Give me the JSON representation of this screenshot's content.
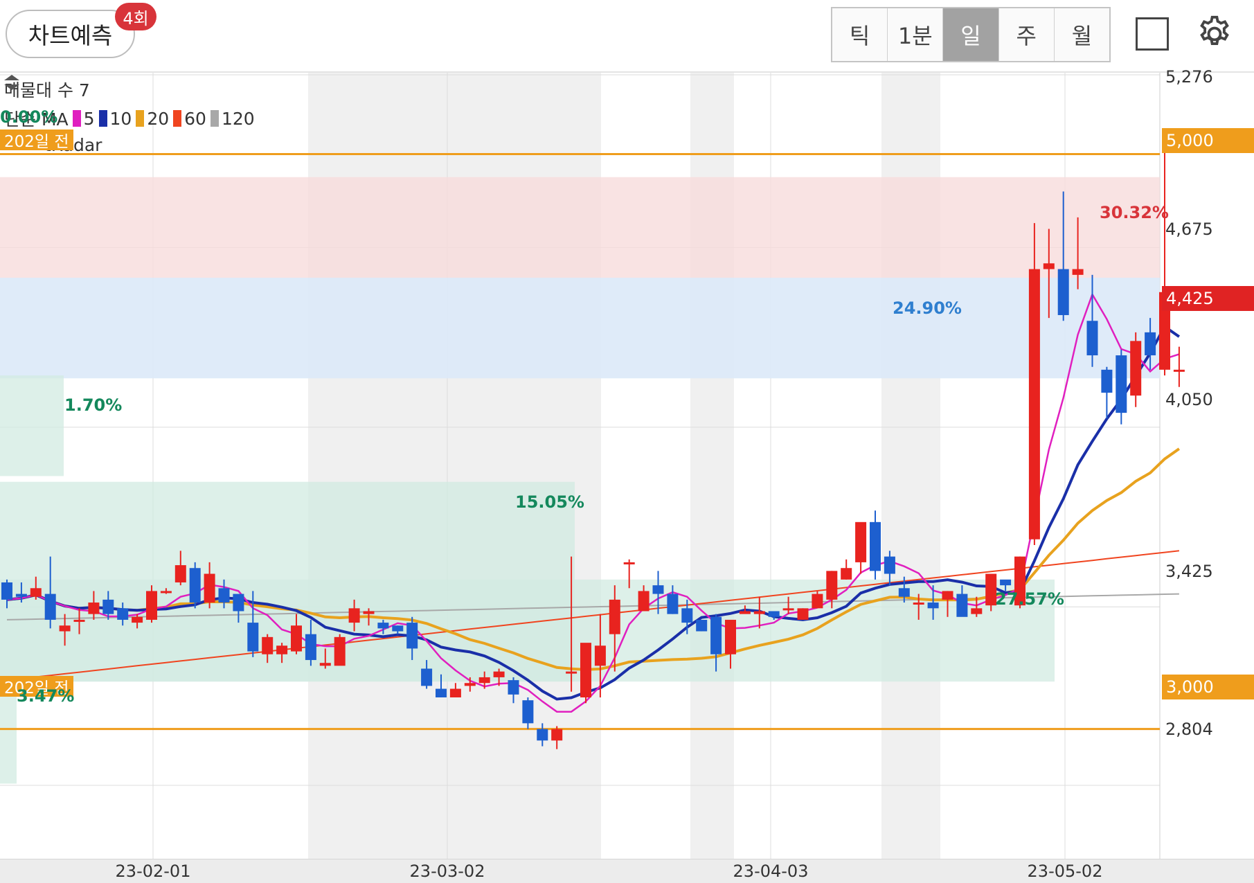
{
  "header": {
    "predict_label": "차트예측",
    "predict_badge": "4회",
    "periods": [
      "틱",
      "1분",
      "일",
      "주",
      "월"
    ],
    "active_period": "일",
    "icons": [
      "square-icon",
      "gear-icon"
    ]
  },
  "legend": {
    "volume_profile_label": "매물대 수 7",
    "ma_prefix": "단순 MA",
    "ma_items": [
      {
        "label": "5",
        "color": "#e01fbf"
      },
      {
        "label": "10",
        "color": "#1a2fa8"
      },
      {
        "label": "20",
        "color": "#e8a21e"
      },
      {
        "label": "60",
        "color": "#f0441f"
      },
      {
        "label": "120",
        "color": "#a8a8a8"
      }
    ],
    "radar_label": "tRadar"
  },
  "y_axis": {
    "ticks": [
      "5,276",
      "4,675",
      "4,050",
      "3,425",
      "2,804"
    ],
    "tags": [
      {
        "text": "5,000",
        "color": "#ef9d1c"
      },
      {
        "text": "4,425",
        "color": "#e02323"
      },
      {
        "text": "3,000",
        "color": "#ef9d1c"
      }
    ]
  },
  "x_axis": {
    "ticks": [
      "23-02-01",
      "23-03-02",
      "23-04-03",
      "23-05-02"
    ]
  },
  "level_lines": [
    {
      "value": 5000,
      "label": "202일 전"
    },
    {
      "value": 3000,
      "label": "202일 전"
    }
  ],
  "percent_labels": [
    {
      "text": "0.00%",
      "color": "#14885c"
    },
    {
      "text": "1.70%",
      "color": "#14885c"
    },
    {
      "text": "15.05%",
      "color": "#14885c"
    },
    {
      "text": "27.57%",
      "color": "#14885c"
    },
    {
      "text": "24.90%",
      "color": "#2f7fcf"
    },
    {
      "text": "30.32%",
      "color": "#d8343a"
    },
    {
      "text": "3.47%",
      "color": "#14885c"
    }
  ],
  "colors": {
    "up": "#e8231f",
    "down": "#1d5fcf",
    "level": "#ef9d1c",
    "sell_zone": "#f8dcdc",
    "buy_zone": "#dbe9f8",
    "volume_zone": "#d2ebe2"
  },
  "chart_data": {
    "type": "candlestick",
    "ylim": [
      2804,
      5276
    ],
    "x": [
      "23-01-09",
      "23-01-10",
      "23-01-11",
      "23-01-12",
      "23-01-13",
      "23-01-16",
      "23-01-17",
      "23-01-18",
      "23-01-19",
      "23-01-20",
      "23-01-25",
      "23-01-26",
      "23-01-27",
      "23-01-30",
      "23-01-31",
      "23-02-01",
      "23-02-02",
      "23-02-03",
      "23-02-06",
      "23-02-07",
      "23-02-08",
      "23-02-09",
      "23-02-10",
      "23-02-13",
      "23-02-14",
      "23-02-15",
      "23-02-16",
      "23-02-17",
      "23-02-20",
      "23-02-21",
      "23-02-22",
      "23-02-23",
      "23-02-24",
      "23-02-27",
      "23-02-28",
      "23-03-02",
      "23-03-03",
      "23-03-06",
      "23-03-07",
      "23-03-08",
      "23-03-09",
      "23-03-10",
      "23-03-13",
      "23-03-14",
      "23-03-15",
      "23-03-16",
      "23-03-17",
      "23-03-20",
      "23-03-21",
      "23-03-22",
      "23-03-23",
      "23-03-24",
      "23-03-27",
      "23-03-28",
      "23-03-29",
      "23-03-30",
      "23-03-31",
      "23-04-03",
      "23-04-04",
      "23-04-05",
      "23-04-06",
      "23-04-07",
      "23-04-10",
      "23-04-11",
      "23-04-12",
      "23-04-13",
      "23-04-14",
      "23-04-17",
      "23-04-18",
      "23-04-19",
      "23-04-20",
      "23-04-21",
      "23-04-24",
      "23-04-25",
      "23-04-26",
      "23-04-27",
      "23-04-28",
      "23-05-02",
      "23-05-03",
      "23-05-04",
      "23-05-08",
      "23-05-09"
    ],
    "candles": [
      [
        3510,
        3520,
        3420,
        3450
      ],
      [
        3470,
        3510,
        3440,
        3460
      ],
      [
        3460,
        3530,
        3450,
        3490
      ],
      [
        3470,
        3600,
        3350,
        3380
      ],
      [
        3340,
        3400,
        3290,
        3360
      ],
      [
        3380,
        3420,
        3330,
        3380
      ],
      [
        3400,
        3480,
        3380,
        3440
      ],
      [
        3450,
        3480,
        3380,
        3400
      ],
      [
        3420,
        3440,
        3360,
        3380
      ],
      [
        3370,
        3400,
        3350,
        3390
      ],
      [
        3380,
        3500,
        3370,
        3480
      ],
      [
        3480,
        3490,
        3470,
        3480
      ],
      [
        3510,
        3620,
        3500,
        3570
      ],
      [
        3560,
        3580,
        3420,
        3440
      ],
      [
        3440,
        3580,
        3420,
        3540
      ],
      [
        3490,
        3520,
        3420,
        3440
      ],
      [
        3470,
        3460,
        3370,
        3410
      ],
      [
        3370,
        3480,
        3250,
        3270
      ],
      [
        3260,
        3330,
        3230,
        3320
      ],
      [
        3260,
        3300,
        3230,
        3290
      ],
      [
        3270,
        3400,
        3260,
        3360
      ],
      [
        3330,
        3380,
        3220,
        3240
      ],
      [
        3220,
        3280,
        3210,
        3230
      ],
      [
        3220,
        3330,
        3230,
        3320
      ],
      [
        3370,
        3450,
        3340,
        3420
      ],
      [
        3400,
        3420,
        3360,
        3410
      ],
      [
        3370,
        3380,
        3330,
        3350
      ],
      [
        3360,
        3360,
        3330,
        3340
      ],
      [
        3370,
        3390,
        3240,
        3280
      ],
      [
        3210,
        3240,
        3140,
        3150
      ],
      [
        3140,
        3190,
        3110,
        3110
      ],
      [
        3110,
        3160,
        3110,
        3140
      ],
      [
        3150,
        3180,
        3130,
        3160
      ],
      [
        3160,
        3200,
        3140,
        3180
      ],
      [
        3180,
        3210,
        3150,
        3200
      ],
      [
        3170,
        3180,
        3090,
        3120
      ],
      [
        3100,
        3110,
        3000,
        3020
      ],
      [
        3000,
        3020,
        2940,
        2960
      ],
      [
        2960,
        3010,
        2930,
        3000
      ],
      [
        3200,
        3600,
        3130,
        3200
      ],
      [
        3110,
        3290,
        3090,
        3300
      ],
      [
        3220,
        3400,
        3110,
        3290
      ],
      [
        3330,
        3500,
        3200,
        3450
      ],
      [
        3580,
        3590,
        3490,
        3580
      ],
      [
        3410,
        3500,
        3430,
        3480
      ],
      [
        3500,
        3550,
        3400,
        3470
      ],
      [
        3470,
        3500,
        3400,
        3400
      ],
      [
        3420,
        3450,
        3330,
        3370
      ],
      [
        3380,
        3370,
        3340,
        3340
      ],
      [
        3390,
        3400,
        3200,
        3260
      ],
      [
        3260,
        3370,
        3210,
        3380
      ],
      [
        3400,
        3430,
        3410,
        3410
      ],
      [
        3400,
        3460,
        3350,
        3410
      ],
      [
        3410,
        3400,
        3380,
        3390
      ],
      [
        3420,
        3460,
        3400,
        3420
      ],
      [
        3380,
        3420,
        3380,
        3420
      ],
      [
        3420,
        3480,
        3430,
        3470
      ],
      [
        3450,
        3550,
        3420,
        3550
      ],
      [
        3520,
        3590,
        3520,
        3560
      ],
      [
        3580,
        3700,
        3540,
        3720
      ],
      [
        3720,
        3760,
        3520,
        3550
      ],
      [
        3600,
        3620,
        3500,
        3540
      ],
      [
        3490,
        3530,
        3440,
        3460
      ],
      [
        3440,
        3470,
        3380,
        3440
      ],
      [
        3440,
        3500,
        3380,
        3420
      ],
      [
        3450,
        3480,
        3390,
        3480
      ],
      [
        3470,
        3500,
        3400,
        3390
      ],
      [
        3400,
        3460,
        3390,
        3420
      ],
      [
        3430,
        3540,
        3410,
        3540
      ],
      [
        3520,
        3510,
        3480,
        3500
      ],
      [
        3430,
        3600,
        3420,
        3600
      ],
      [
        3660,
        4760,
        3640,
        4600
      ],
      [
        4600,
        4740,
        4430,
        4620
      ],
      [
        4600,
        4870,
        4420,
        4440
      ],
      [
        4580,
        4780,
        4530,
        4600
      ],
      [
        4420,
        4580,
        4260,
        4300
      ],
      [
        4250,
        4260,
        4080,
        4170
      ],
      [
        4300,
        4320,
        4060,
        4100
      ],
      [
        4160,
        4380,
        4120,
        4350
      ],
      [
        4380,
        4430,
        4250,
        4300
      ],
      [
        4250,
        5020,
        4230,
        4520
      ],
      [
        4250,
        4330,
        4190,
        4250
      ]
    ]
  }
}
